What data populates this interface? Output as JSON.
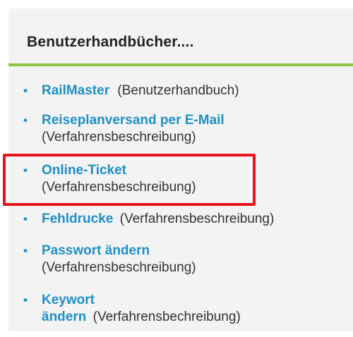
{
  "panel": {
    "title": "Benutzerhandbücher...."
  },
  "items": [
    {
      "link": "RailMaster",
      "desc_inline": "(Benutzerhandbuch)"
    },
    {
      "link": "Reiseplanversand per E-Mail",
      "desc": "(Verfahrensbeschreibung)"
    },
    {
      "link": "Online-Ticket",
      "desc": "(Verfahrensbeschreibung)",
      "highlighted": true
    },
    {
      "link": "Fehldrucke",
      "desc_inline": "(Verfahrensbeschreibung)"
    },
    {
      "link": "Passwort ändern",
      "desc": "(Verfahrensbeschreibung)"
    },
    {
      "link_line1": "Keywort",
      "link_line2": "ändern",
      "desc_inline": "(Verfahrensbechreibung)"
    }
  ],
  "colors": {
    "link": "#1f8fc6",
    "accent_line": "#8cc63f",
    "highlight_border": "#e8141b",
    "panel_bg": "#f3f3f3"
  }
}
